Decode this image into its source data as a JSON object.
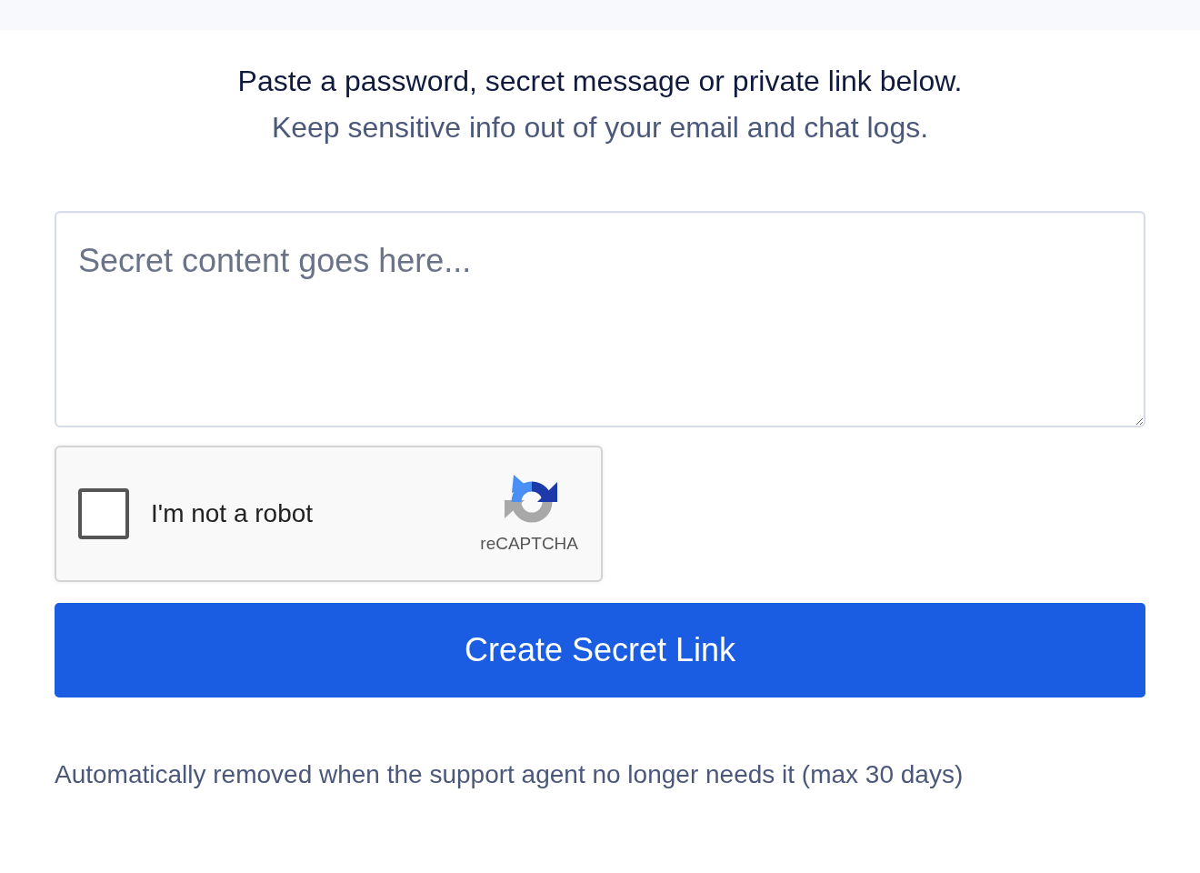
{
  "intro": {
    "headline": "Paste a password, secret message or private link below.",
    "subline": "Keep sensitive info out of your email and chat logs."
  },
  "secret_field": {
    "placeholder": "Secret content goes here..."
  },
  "captcha": {
    "label": "I'm not a robot",
    "checked": false,
    "brand": "reCAPTCHA"
  },
  "submit_button": {
    "label": "Create Secret Link"
  },
  "note": "Automatically removed when the support agent no longer needs it (max 30 days)"
}
